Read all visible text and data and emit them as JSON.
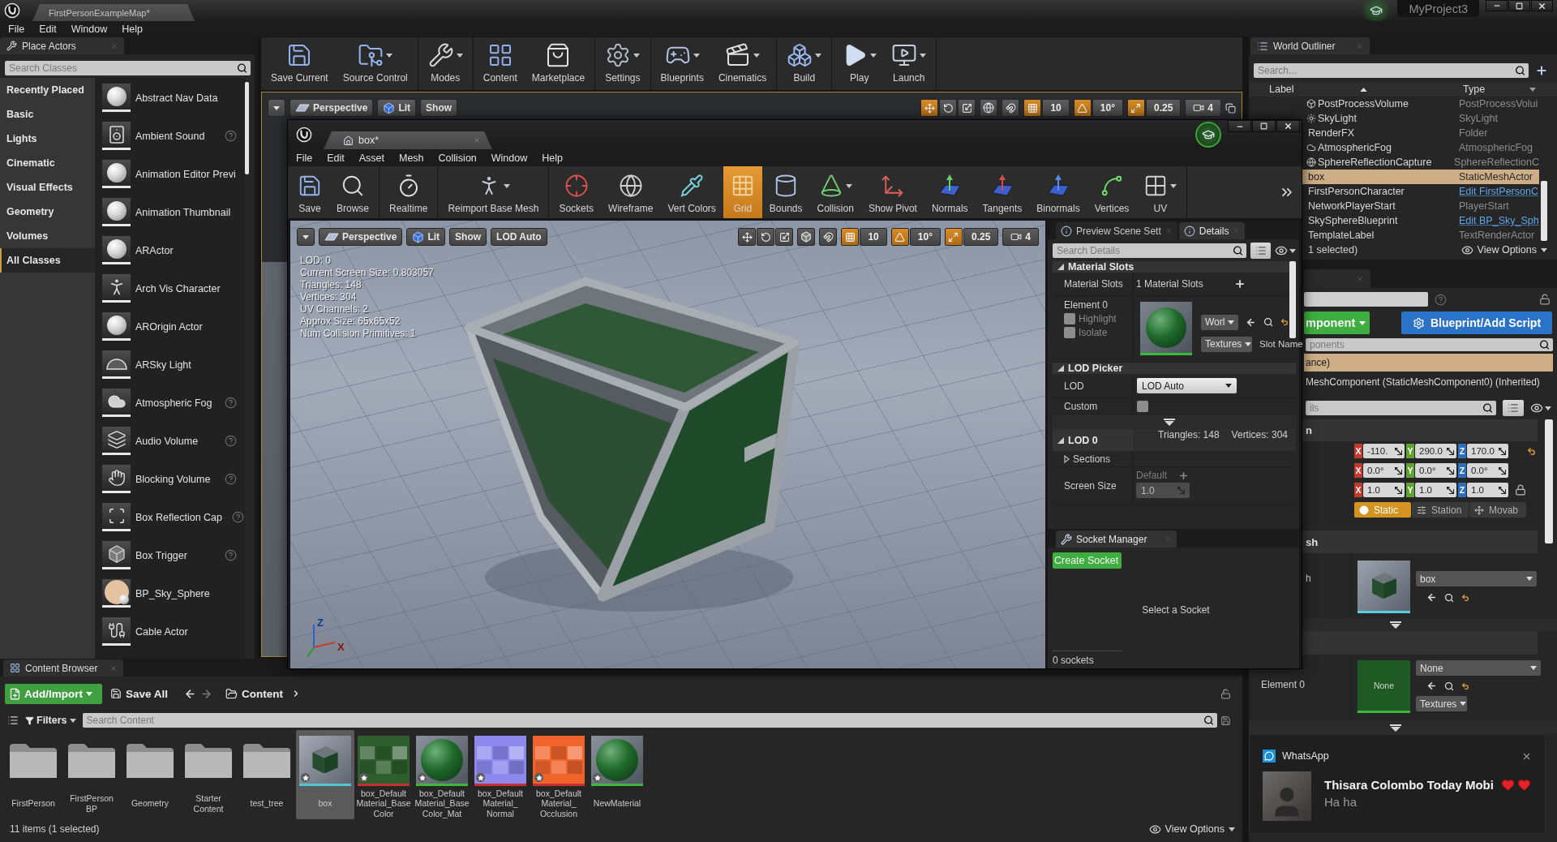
{
  "title_bar": {
    "tab": "FirstPersonExampleMap*",
    "project": "MyProject3"
  },
  "menu": [
    "File",
    "Edit",
    "Window",
    "Help"
  ],
  "place_actors": {
    "tab": "Place Actors",
    "search": {
      "placeholder": "Search Classes"
    },
    "categories": [
      {
        "label": "Recently Placed",
        "selected": false
      },
      {
        "label": "Basic",
        "selected": false
      },
      {
        "label": "Lights",
        "selected": false
      },
      {
        "label": "Cinematic",
        "selected": false
      },
      {
        "label": "Visual Effects",
        "selected": false
      },
      {
        "label": "Geometry",
        "selected": false
      },
      {
        "label": "Volumes",
        "selected": false
      },
      {
        "label": "All Classes",
        "selected": true
      }
    ],
    "items": [
      {
        "label": "Abstract Nav Data",
        "kind": "sphere",
        "help": false
      },
      {
        "label": "Ambient Sound",
        "kind": "speaker",
        "help": true
      },
      {
        "label": "Animation Editor Previ",
        "kind": "sphere",
        "help": false
      },
      {
        "label": "Animation Thumbnail",
        "kind": "sphere",
        "help": false
      },
      {
        "label": "ARActor",
        "kind": "sphere",
        "help": false
      },
      {
        "label": "Arch Vis Character",
        "kind": "figure",
        "help": false
      },
      {
        "label": "AROrigin Actor",
        "kind": "sphere",
        "help": false
      },
      {
        "label": "ARSky Light",
        "kind": "dome",
        "help": false
      },
      {
        "label": "Atmospheric Fog",
        "kind": "cloud",
        "help": true
      },
      {
        "label": "Audio Volume",
        "kind": "volume",
        "help": true
      },
      {
        "label": "Blocking Volume",
        "kind": "hand",
        "help": true
      },
      {
        "label": "Box Reflection Cap",
        "kind": "capture",
        "help": true
      },
      {
        "label": "Box Trigger",
        "kind": "cube",
        "help": true
      },
      {
        "label": "BP_Sky_Sphere",
        "kind": "sky",
        "help": false
      },
      {
        "label": "Cable Actor",
        "kind": "cable",
        "help": false
      }
    ]
  },
  "toolbar": {
    "groups": [
      {
        "buttons": [
          {
            "label": "Save Current",
            "kind": "save",
            "dropdown": false
          },
          {
            "label": "Source Control",
            "kind": "source",
            "dropdown": true
          }
        ]
      },
      {
        "buttons": [
          {
            "label": "Modes",
            "kind": "modes",
            "dropdown": true
          }
        ]
      },
      {
        "buttons": [
          {
            "label": "Content",
            "kind": "content",
            "dropdown": false
          },
          {
            "label": "Marketplace",
            "kind": "market",
            "dropdown": false
          }
        ]
      },
      {
        "buttons": [
          {
            "label": "Settings",
            "kind": "settings",
            "dropdown": true
          }
        ]
      },
      {
        "buttons": [
          {
            "label": "Blueprints",
            "kind": "blueprints",
            "dropdown": true
          },
          {
            "label": "Cinematics",
            "kind": "cinematics",
            "dropdown": true
          }
        ]
      },
      {
        "buttons": [
          {
            "label": "Build",
            "kind": "build",
            "dropdown": true
          }
        ]
      },
      {
        "buttons": [
          {
            "label": "Play",
            "kind": "play",
            "dropdown": true
          },
          {
            "label": "Launch",
            "kind": "launch",
            "dropdown": true
          }
        ]
      }
    ]
  },
  "viewport": {
    "buttons": [
      {
        "label": "Perspective",
        "kind": "perspective"
      },
      {
        "label": "Lit",
        "kind": "lit"
      },
      {
        "label": "Show",
        "kind": "plain"
      }
    ],
    "transform": [
      {
        "kind": "move",
        "selected": true
      },
      {
        "kind": "rotate",
        "selected": false
      },
      {
        "kind": "scale",
        "selected": false
      }
    ],
    "world_space": true,
    "snaps": [
      {
        "kind": "surface",
        "on": false
      },
      {
        "kind": "grid",
        "value": "10",
        "on": true
      },
      {
        "kind": "angle",
        "value": "10°",
        "on": true
      },
      {
        "kind": "scale",
        "value": "0.25",
        "on": true
      },
      {
        "kind": "camera",
        "value": "4"
      }
    ],
    "maximize_button": true
  },
  "mesh_editor": {
    "tab": "box*",
    "menu": [
      "File",
      "Edit",
      "Asset",
      "Mesh",
      "Collision",
      "Window",
      "Help"
    ],
    "toolbar": {
      "groups": [
        {
          "buttons": [
            {
              "label": "Save",
              "kind": "save",
              "dropdown": false
            },
            {
              "label": "Browse",
              "kind": "browse",
              "dropdown": false
            }
          ]
        },
        {
          "buttons": [
            {
              "label": "Realtime",
              "kind": "realtime",
              "dropdown": false,
              "on": false
            }
          ]
        },
        {
          "buttons": [
            {
              "label": "Reimport Base Mesh",
              "kind": "reimport",
              "dropdown": true
            }
          ]
        },
        {
          "buttons": [
            {
              "label": "Sockets",
              "kind": "sockets",
              "dropdown": false,
              "on": false
            },
            {
              "label": "Wireframe",
              "kind": "wireframe",
              "dropdown": false,
              "on": false
            },
            {
              "label": "Vert Colors",
              "kind": "vertcolors",
              "dropdown": false,
              "on": false
            },
            {
              "label": "Grid",
              "kind": "grid",
              "dropdown": false,
              "on": true
            },
            {
              "label": "Bounds",
              "kind": "bounds",
              "dropdown": false,
              "on": false
            },
            {
              "label": "Collision",
              "kind": "collision",
              "dropdown": true,
              "on": false
            },
            {
              "label": "Show Pivot",
              "kind": "pivot",
              "dropdown": false,
              "on": false
            },
            {
              "label": "Normals",
              "kind": "normals",
              "dropdown": false,
              "on": false
            },
            {
              "label": "Tangents",
              "kind": "tangents",
              "dropdown": false,
              "on": false
            },
            {
              "label": "Binormals",
              "kind": "binormals",
              "dropdown": false,
              "on": false
            },
            {
              "label": "Vertices",
              "kind": "vertices",
              "dropdown": false,
              "on": false
            },
            {
              "label": "UV",
              "kind": "uv",
              "dropdown": true,
              "on": false
            }
          ]
        }
      ]
    },
    "viewport": {
      "buttons": [
        {
          "label": "Perspective",
          "kind": "perspective"
        },
        {
          "label": "Lit",
          "kind": "lit"
        },
        {
          "label": "Show",
          "kind": "plain"
        },
        {
          "label": "LOD Auto",
          "kind": "plain"
        }
      ],
      "transform": [
        {
          "kind": "move",
          "selected": false
        },
        {
          "kind": "rotate",
          "selected": false
        },
        {
          "kind": "scale",
          "selected": false
        }
      ],
      "world_space": false,
      "snaps": [
        {
          "kind": "surface",
          "on": false
        },
        {
          "kind": "grid",
          "value": "10",
          "on": true
        },
        {
          "kind": "angle",
          "value": "10°",
          "on": true
        },
        {
          "kind": "scale",
          "value": "0.25",
          "on": true
        },
        {
          "kind": "camera",
          "value": "4"
        }
      ],
      "maximize_button": false,
      "stats": [
        "LOD: 0",
        "Current Screen Size: 0.803057",
        "Triangles: 148",
        "Vertices: 304",
        "UV Channels: 2",
        "Approx Size: 65x65x52",
        "Num Collision Primitives: 1"
      ],
      "axes": [
        "Z",
        "X"
      ]
    },
    "details": {
      "tabs": [
        {
          "label": "Preview Scene Sett",
          "selected": false
        },
        {
          "label": "Details",
          "selected": true
        }
      ],
      "search": {
        "placeholder": "Search Details"
      },
      "material_slots": {
        "title": "Material Slots",
        "expanded": true,
        "label": "Material Slots",
        "value": "1 Material Slots",
        "element": "Element 0",
        "highlight": {
          "label": "Highlight",
          "checked": false
        },
        "isolate": {
          "label": "Isolate",
          "checked": false
        },
        "material": "Worl",
        "textures": "Textures",
        "slot_name": "Slot Name"
      },
      "lod_picker": {
        "title": "LOD Picker",
        "expanded": true,
        "lod": {
          "label": "LOD",
          "value": "LOD Auto"
        },
        "custom": {
          "label": "Custom",
          "checked": false
        }
      },
      "lod0": {
        "title": "LOD 0",
        "expanded": true,
        "triangles": "Triangles: 148",
        "vertices": "Vertices: 304",
        "sections": {
          "label": "Sections",
          "expanded": false
        },
        "screen_size": {
          "label": "Screen Size",
          "default": "Default",
          "value": "1.0"
        }
      }
    },
    "sockets": {
      "tab": "Socket Manager",
      "create": "Create Socket",
      "empty": "Select a Socket",
      "count": "0 sockets"
    }
  },
  "outliner": {
    "tab": "World Outliner",
    "search": {
      "placeholder": "Search..."
    },
    "columns": [
      "Label",
      "Type"
    ],
    "rows": [
      {
        "label": "PostProcessVolume",
        "type": "PostProcessVolui",
        "kind": "volume",
        "selected": false,
        "link": false
      },
      {
        "label": "SkyLight",
        "type": "SkyLight",
        "kind": "light",
        "selected": false,
        "link": false
      },
      {
        "label": "RenderFX",
        "type": "Folder",
        "kind": "plain",
        "selected": false,
        "link": false
      },
      {
        "label": "AtmosphericFog",
        "type": "AtmosphericFog",
        "kind": "fog",
        "selected": false,
        "link": false
      },
      {
        "label": "SphereReflectionCapture",
        "type": "SphereReflectionC",
        "kind": "capture",
        "selected": false,
        "link": false
      },
      {
        "label": "box",
        "type": "StaticMeshActor",
        "kind": "plain",
        "selected": true,
        "link": false
      },
      {
        "label": "FirstPersonCharacter",
        "type": "Edit FirstPersonC",
        "kind": "plain",
        "selected": false,
        "link": true
      },
      {
        "label": "NetworkPlayerStart",
        "type": "PlayerStart",
        "kind": "plain",
        "selected": false,
        "link": false
      },
      {
        "label": "SkySphereBlueprint",
        "type": "Edit BP_Sky_Sph",
        "kind": "plain",
        "selected": false,
        "link": true
      },
      {
        "label": "TemplateLabel",
        "type": "TextRenderActor",
        "kind": "plain",
        "selected": false,
        "link": false
      }
    ],
    "status": "1 selected)",
    "view_options": "View Options"
  },
  "details_panel": {
    "add_component": "mponent",
    "blueprint": "Blueprint/Add Script",
    "search_components": {
      "placeholder": "ponents"
    },
    "components": [
      {
        "label": "ance)",
        "selected": true
      },
      {
        "label": "MeshComponent (StaticMeshComponent0) (Inherited)",
        "selected": false
      }
    ],
    "search": {
      "placeholder": "ils"
    },
    "transform": {
      "title": "n",
      "rows": [
        {
          "kind": "location",
          "fields": [
            {
              "axis": "X",
              "value": "-110.",
              "color": "#c0392b"
            },
            {
              "axis": "Y",
              "value": "290.0",
              "color": "#62a234"
            },
            {
              "axis": "Z",
              "value": "170.0",
              "color": "#2e6fbe"
            }
          ]
        },
        {
          "kind": "rotation",
          "fields": [
            {
              "axis": "X",
              "value": "0.0°",
              "color": "#c0392b"
            },
            {
              "axis": "Y",
              "value": "0.0°",
              "color": "#62a234"
            },
            {
              "axis": "Z",
              "value": "0.0°",
              "color": "#2e6fbe"
            }
          ]
        },
        {
          "kind": "scale",
          "fields": [
            {
              "axis": "X",
              "value": "1.0",
              "color": "#c0392b"
            },
            {
              "axis": "Y",
              "value": "1.0",
              "color": "#62a234"
            },
            {
              "axis": "Z",
              "value": "1.0",
              "color": "#2e6fbe"
            }
          ]
        }
      ],
      "mobility": [
        {
          "label": "Static",
          "kind": "static",
          "selected": true
        },
        {
          "label": "Station",
          "kind": "stationary",
          "selected": false
        },
        {
          "label": "Movab",
          "kind": "movable",
          "selected": false
        }
      ]
    },
    "static_mesh": {
      "title": "sh",
      "label": "h",
      "value": "box"
    },
    "materials": {
      "label": "Element 0",
      "preview": "None",
      "value": "None",
      "textures": "Textures"
    }
  },
  "content_browser": {
    "tab": "Content Browser",
    "add": "Add/Import",
    "save_all": "Save All",
    "path": "Content",
    "filters": "Filters",
    "search": {
      "placeholder": "Search Content"
    },
    "assets": [
      {
        "label": "FirstPerson",
        "kind": "folder",
        "selected": false,
        "new": false
      },
      {
        "label": "FirstPerson\nBP",
        "kind": "folder",
        "selected": false,
        "new": false
      },
      {
        "label": "Geometry",
        "kind": "folder",
        "selected": false,
        "new": false
      },
      {
        "label": "Starter\nContent",
        "kind": "folder",
        "selected": false,
        "new": false
      },
      {
        "label": "test_tree",
        "kind": "folder",
        "selected": false,
        "new": false
      },
      {
        "label": "box",
        "kind": "mesh",
        "selected": true,
        "new": true
      },
      {
        "label": "box_Default\nMaterial_Base\nColor",
        "kind": "texture",
        "color": "#2e5e2e",
        "selected": false,
        "new": true
      },
      {
        "label": "box_Default\nMaterial_Base\nColor_Mat",
        "kind": "material",
        "selected": false,
        "new": true
      },
      {
        "label": "box_Default\nMaterial_\nNormal",
        "kind": "texture",
        "color": "#8c88ee",
        "selected": false,
        "new": true
      },
      {
        "label": "box_Default\nMaterial_\nOcclusion",
        "kind": "texture",
        "color": "#f0642c",
        "selected": false,
        "new": true
      },
      {
        "label": "NewMaterial",
        "kind": "material",
        "selected": false,
        "new": true
      }
    ],
    "status": "11 items (1 selected)",
    "view_options": "View Options"
  },
  "notification": {
    "app": "WhatsApp",
    "title": "Thisara Colombo Today Mobi",
    "message": "Ha ha"
  }
}
